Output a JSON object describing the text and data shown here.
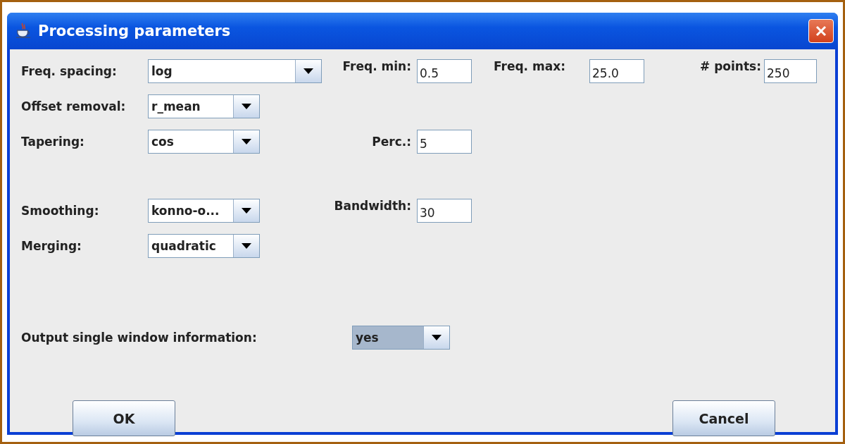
{
  "window": {
    "title": "Processing parameters"
  },
  "rows": [
    {
      "label": "Freq. spacing:",
      "combo": {
        "value": "log",
        "focused": false
      },
      "params": [
        {
          "label": "Freq. min:",
          "value": "0.5"
        },
        {
          "label": "Freq. max:",
          "value": "25.0"
        },
        {
          "label": "# points:",
          "value": "250"
        }
      ]
    },
    {
      "label": "Offset removal:",
      "combo": {
        "value": "r_mean",
        "focused": false
      },
      "params": []
    },
    {
      "label": "Tapering:",
      "combo": {
        "value": "cos",
        "focused": false
      },
      "params": [
        {
          "label": "Perc.:",
          "value": "5"
        }
      ]
    },
    {
      "label": "Smoothing:",
      "combo": {
        "value": "konno-o...",
        "focused": false
      },
      "params": [
        {
          "label": "Bandwidth:",
          "value": "30"
        }
      ]
    },
    {
      "label": "Merging:",
      "combo": {
        "value": "quadratic",
        "focused": false
      },
      "params": []
    }
  ],
  "output": {
    "label": "Output single window information:",
    "combo": {
      "value": "yes",
      "focused": true
    }
  },
  "buttons": [
    "OK",
    "Cancel"
  ]
}
